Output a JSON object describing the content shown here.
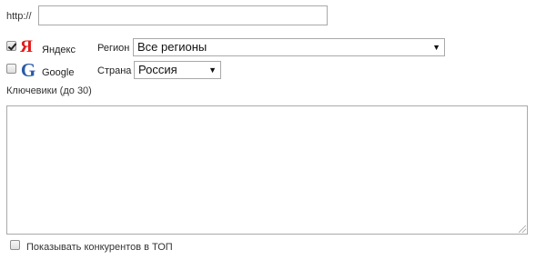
{
  "url_row": {
    "prefix_label": "http://",
    "url_value": "",
    "url_placeholder": ""
  },
  "engines": [
    {
      "name": "Яндекс",
      "icon": "yandex-logo-icon",
      "checked": true,
      "field_label": "Регион",
      "field_value": "Все регионы"
    },
    {
      "name": "Google",
      "icon": "google-logo-icon",
      "checked": false,
      "field_label": "Страна",
      "field_value": "Россия"
    }
  ],
  "logos": {
    "yandex_glyph": "Я",
    "google_glyph": "G",
    "yandex_color": "#e21b1b",
    "google_color": "#2b5aa8"
  },
  "keywords": {
    "label": "Ключевики (до 30)",
    "value": ""
  },
  "competitors": {
    "label": "Показывать конкурентов в ТОП",
    "checked": false
  },
  "icons": {
    "dropdown_arrow": "▼"
  }
}
